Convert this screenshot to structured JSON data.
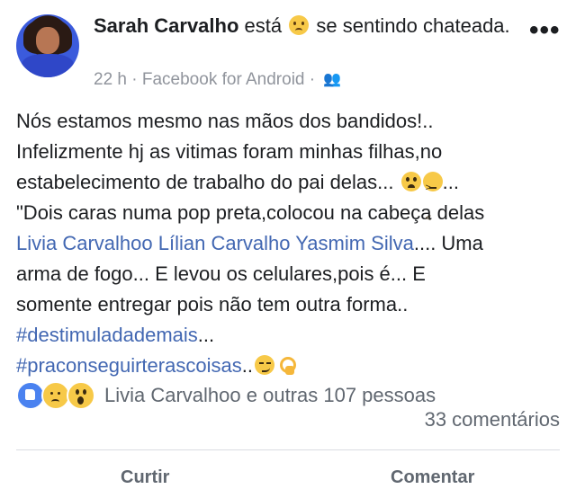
{
  "post": {
    "author": "Sarah Carvalho",
    "feeling_prefix": "está",
    "feeling_icon": "sad-face-emoji",
    "feeling_text": "se sentindo chateada.",
    "time": "22 h",
    "separator": "·",
    "source": "Facebook for Android",
    "audience_icon": "friends-icon",
    "more_label": "•••"
  },
  "content": {
    "line1": "Nós estamos mesmo nas mãos dos bandidos!..",
    "line2": "Infelizmente hj as vitimas foram minhas filhas,no",
    "line3": "estabelecimento de trabalho do pai delas...",
    "line3_end": "...",
    "line4": "\"Dois caras numa pop preta,colocou na cabeça delas",
    "tags": [
      "Livia Carvalhoo",
      "Lílian Carvalho",
      "Yasmim Silva"
    ],
    "line5_end": ".... Uma",
    "line6": "arma de fogo... E levou os celulares,pois é... E",
    "line7": "somente entregar pois não tem outra forma..",
    "hashtag1": "#destimuladademais",
    "hashtag1_end": "...",
    "hashtag2": "#praconseguirterascoisas",
    "hashtag2_end": ".."
  },
  "reactions": {
    "icons": [
      "like-icon",
      "sad-icon",
      "wow-icon"
    ],
    "summary": "Livia Carvalhoo e outras 107 pessoas",
    "comments": "33 comentários"
  },
  "actions": {
    "like_label": "Curtir",
    "comment_label": "Comentar"
  },
  "colors": {
    "link": "#4267b2",
    "meta": "#90949c",
    "like_blue": "#4a82f0",
    "emoji_yellow": "#f7c948"
  }
}
